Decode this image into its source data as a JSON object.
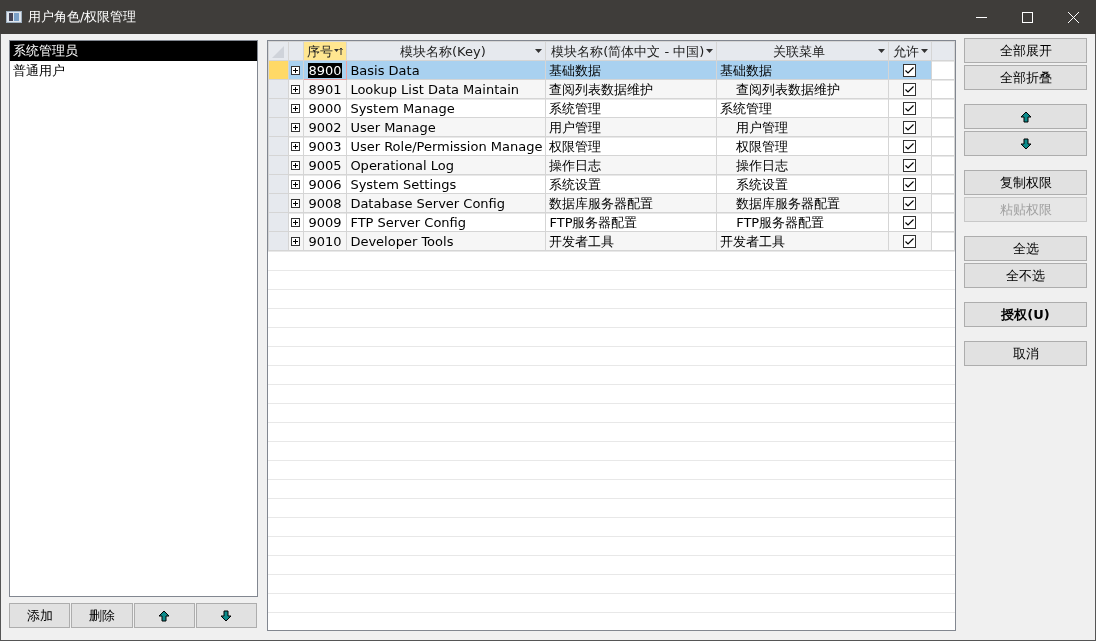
{
  "window": {
    "title": "用户角色/权限管理"
  },
  "roles": [
    {
      "label": "系统管理员",
      "selected": true
    },
    {
      "label": "普通用户",
      "selected": false
    }
  ],
  "role_buttons": [
    {
      "kind": "text",
      "label": "添加"
    },
    {
      "kind": "text",
      "label": "删除"
    },
    {
      "kind": "up"
    },
    {
      "kind": "down"
    }
  ],
  "table": {
    "columns": [
      {
        "label": "序号",
        "sorted": true
      },
      {
        "label": "模块名称(Key)",
        "sorted": false
      },
      {
        "label": "模块名称(简体中文 - 中国)",
        "sorted": false
      },
      {
        "label": "关联菜单",
        "sorted": false
      },
      {
        "label": "允许",
        "sorted": false
      }
    ],
    "rows": [
      {
        "no": "8900",
        "key": "Basis Data",
        "name": "基础数据",
        "menu": "基础数据",
        "menu_indented": false,
        "allowed": true,
        "selected": true
      },
      {
        "no": "8901",
        "key": "Lookup List Data Maintain",
        "name": "查阅列表数据维护",
        "menu": "查阅列表数据维护",
        "menu_indented": true,
        "allowed": true,
        "selected": false
      },
      {
        "no": "9000",
        "key": "System Manage",
        "name": "系统管理",
        "menu": "系统管理",
        "menu_indented": false,
        "allowed": true,
        "selected": false
      },
      {
        "no": "9002",
        "key": "User Manage",
        "name": "用户管理",
        "menu": "用户管理",
        "menu_indented": true,
        "allowed": true,
        "selected": false
      },
      {
        "no": "9003",
        "key": "User Role/Permission Manage",
        "name": "权限管理",
        "menu": "权限管理",
        "menu_indented": true,
        "allowed": true,
        "selected": false
      },
      {
        "no": "9005",
        "key": "Operational Log",
        "name": "操作日志",
        "menu": "操作日志",
        "menu_indented": true,
        "allowed": true,
        "selected": false
      },
      {
        "no": "9006",
        "key": "System Settings",
        "name": "系统设置",
        "menu": "系统设置",
        "menu_indented": true,
        "allowed": true,
        "selected": false
      },
      {
        "no": "9008",
        "key": "Database Server Config",
        "name": "数据库服务器配置",
        "menu": "数据库服务器配置",
        "menu_indented": true,
        "allowed": true,
        "selected": false
      },
      {
        "no": "9009",
        "key": "FTP Server Config",
        "name": "FTP服务器配置",
        "menu": "FTP服务器配置",
        "menu_indented": true,
        "allowed": true,
        "selected": false
      },
      {
        "no": "9010",
        "key": "Developer Tools",
        "name": "开发者工具",
        "menu": "开发者工具",
        "menu_indented": false,
        "allowed": true,
        "selected": false
      }
    ]
  },
  "side_buttons": [
    [
      {
        "kind": "text",
        "label": "全部展开",
        "disabled": false,
        "bold": false
      },
      {
        "kind": "text",
        "label": "全部折叠",
        "disabled": false,
        "bold": false
      }
    ],
    [
      {
        "kind": "up",
        "disabled": false
      },
      {
        "kind": "down",
        "disabled": false
      }
    ],
    [
      {
        "kind": "text",
        "label": "复制权限",
        "disabled": false,
        "bold": false
      },
      {
        "kind": "text",
        "label": "粘贴权限",
        "disabled": true,
        "bold": false
      }
    ],
    [
      {
        "kind": "text",
        "label": "全选",
        "disabled": false,
        "bold": false
      },
      {
        "kind": "text",
        "label": "全不选",
        "disabled": false,
        "bold": false
      }
    ],
    [
      {
        "kind": "text",
        "label": "授权(U)",
        "disabled": false,
        "bold": true
      }
    ],
    [
      {
        "kind": "text",
        "label": "取消",
        "disabled": false,
        "bold": false
      }
    ]
  ]
}
